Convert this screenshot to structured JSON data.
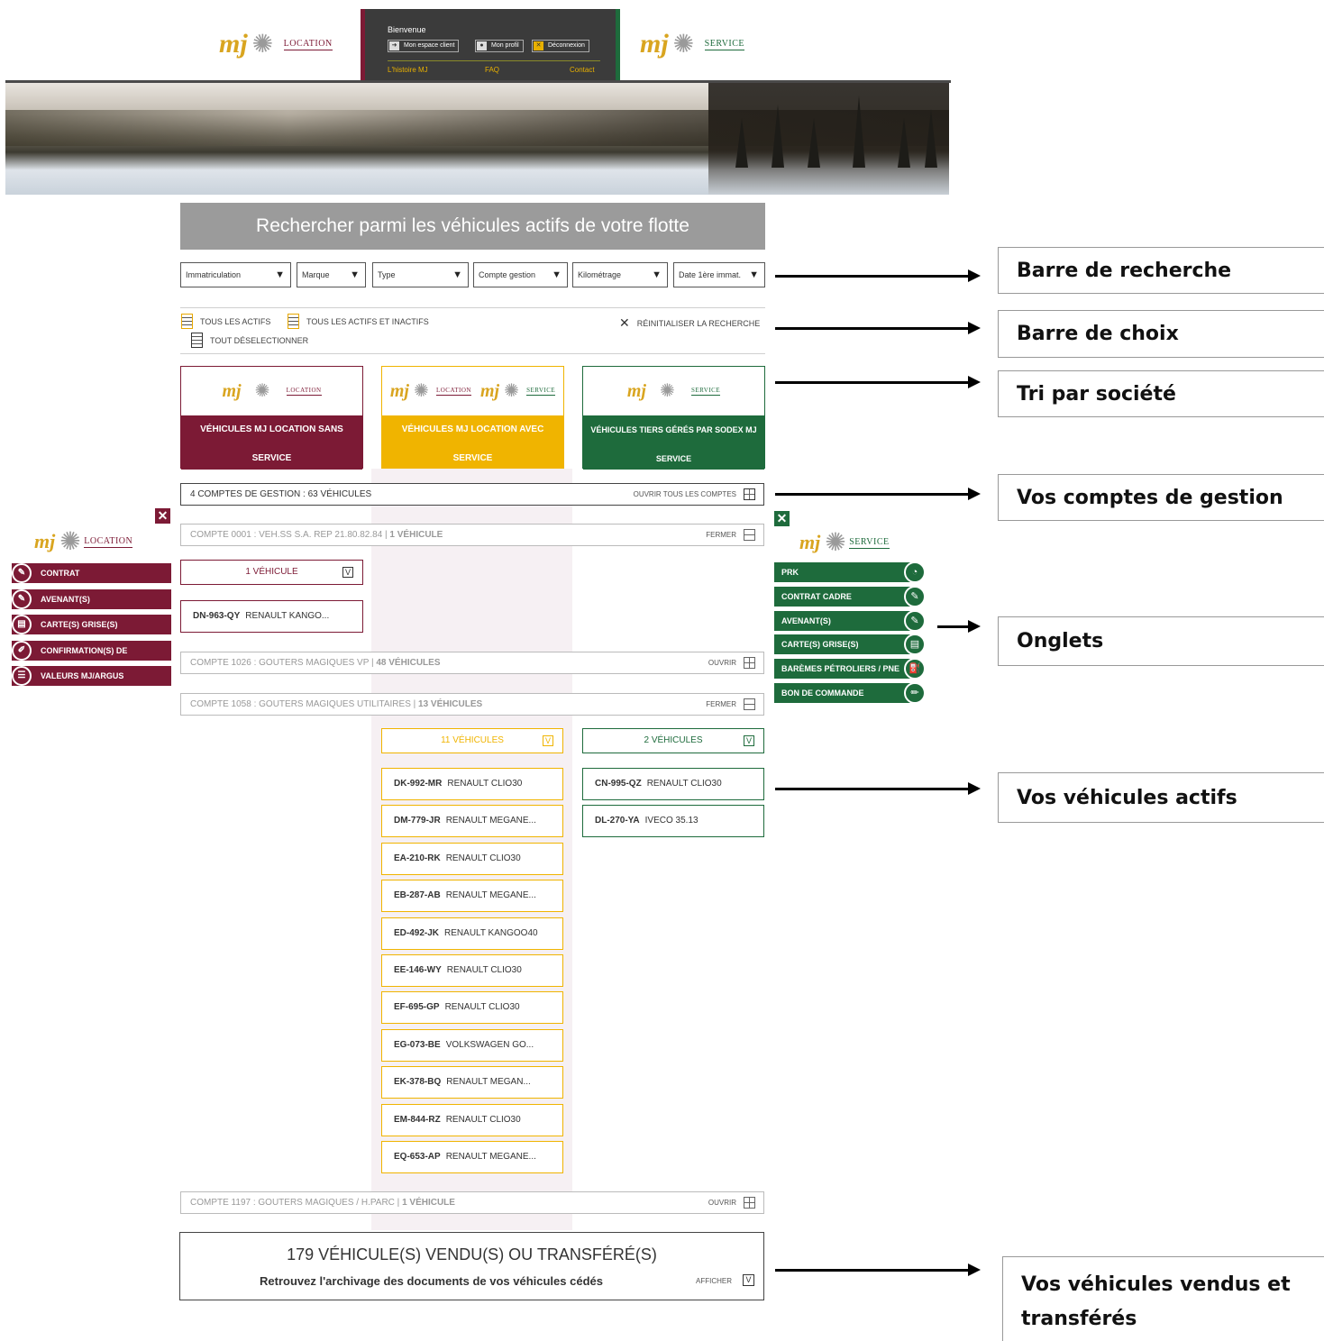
{
  "header": {
    "left_logo": {
      "mark": "mj",
      "label": "LOCATION"
    },
    "right_logo": {
      "mark": "mj",
      "label": "SERVICE"
    },
    "welcome": "Bienvenue",
    "buttons": [
      {
        "label": "Mon espace client",
        "icon": "arrow-icon"
      },
      {
        "label": "Mon profil",
        "icon": "user-icon"
      },
      {
        "label": "Déconnexion",
        "icon": "close-icon"
      }
    ],
    "links": [
      "L'histoire MJ",
      "FAQ",
      "Contact"
    ]
  },
  "search": {
    "title": "Rechercher parmi les véhicules actifs de votre flotte",
    "filters": [
      "Immatriculation",
      "Marque",
      "Type",
      "Compte gestion",
      "Kilométrage",
      "Date 1ère immat."
    ]
  },
  "choices": {
    "all_active": "TOUS LES ACTIFS",
    "all_active_inactive": "TOUS LES ACTIFS ET INACTIFS",
    "deselect_all": "TOUT DÉSELECTIONNER",
    "reset": "RÉINITIALISER LA RECHERCHE"
  },
  "companies": [
    {
      "title": "VÉHICULES MJ LOCATION SANS SERVICE",
      "line1": "VÉHICULES MJ LOCATION SANS",
      "line2": "SERVICE",
      "color": "#7c1a35"
    },
    {
      "title": "VÉHICULES MJ LOCATION AVEC SERVICE",
      "line1": "VÉHICULES MJ LOCATION AVEC",
      "line2": "SERVICE",
      "color": "#f0b400"
    },
    {
      "title": "VÉHICULES TIERS GÉRÉS PAR SODEX MJ SERVICE",
      "line1": "VÉHICULES TIERS GÉRÉS PAR SODEX MJ",
      "line2": "SERVICE",
      "color": "#1e6b3c"
    }
  ],
  "accounts_summary": {
    "label": "4 COMPTES DE GESTION : 63 VÉHICULES",
    "action": "OUVRIR TOUS LES COMPTES"
  },
  "accounts": [
    {
      "prefix": "COMPTE 0001 : VEH.SS S.A. REP 21.80.82.84 | ",
      "count": "1 VÉHICULE",
      "action": "FERMER"
    },
    {
      "prefix": "COMPTE 1026 : GOUTERS MAGIQUES VP | ",
      "count": "48 VÉHICULES",
      "action": "OUVRIR"
    },
    {
      "prefix": "COMPTE 1058 : GOUTERS MAGIQUES UTILITAIRES | ",
      "count": "13 VÉHICULES",
      "action": "FERMER"
    },
    {
      "prefix": "COMPTE 1197 : GOUTERS MAGIQUES / H.PARC | ",
      "count": "1 VÉHICULE",
      "action": "OUVRIR"
    }
  ],
  "groups": {
    "acc1_loc": "1 VÉHICULE",
    "acc3_yellow": "11 VÉHICULES",
    "acc3_green": "2 VÉHICULES",
    "check": "V"
  },
  "vehicles": {
    "acc1_loc": [
      {
        "plate": "DN-963-QY",
        "model": "RENAULT KANGO..."
      }
    ],
    "acc3_yellow": [
      {
        "plate": "DK-992-MR",
        "model": "RENAULT CLIO30"
      },
      {
        "plate": "DM-779-JR",
        "model": "RENAULT MEGANE..."
      },
      {
        "plate": "EA-210-RK",
        "model": "RENAULT CLIO30"
      },
      {
        "plate": "EB-287-AB",
        "model": "RENAULT MEGANE..."
      },
      {
        "plate": "ED-492-JK",
        "model": "RENAULT KANGOO40"
      },
      {
        "plate": "EE-146-WY",
        "model": "RENAULT CLIO30"
      },
      {
        "plate": "EF-695-GP",
        "model": "RENAULT CLIO30"
      },
      {
        "plate": "EG-073-BE",
        "model": "VOLKSWAGEN GO..."
      },
      {
        "plate": "EK-378-BQ",
        "model": "RENAULT MEGAN..."
      },
      {
        "plate": "EM-844-RZ",
        "model": "RENAULT CLIO30"
      },
      {
        "plate": "EQ-653-AP",
        "model": "RENAULT MEGANE..."
      }
    ],
    "acc3_green": [
      {
        "plate": "CN-995-QZ",
        "model": "RENAULT CLIO30"
      },
      {
        "plate": "DL-270-YA",
        "model": "IVECO 35.13"
      }
    ]
  },
  "sold": {
    "title": "179 VÉHICULE(S) VENDU(S) OU TRANSFÉRÉ(S)",
    "subtitle": "Retrouvez l'archivage des documents de vos véhicules cédés",
    "action": "AFFICHER",
    "check": "V"
  },
  "left_menu": {
    "close": "✕",
    "logo_label": "LOCATION",
    "items": [
      {
        "label": "CONTRAT",
        "icon": "document-icon"
      },
      {
        "label": "AVENANT(S)",
        "icon": "document-edit-icon"
      },
      {
        "label": "CARTE(S) GRISE(S)",
        "icon": "card-icon"
      },
      {
        "label": "CONFIRMATION(S) DE",
        "icon": "brush-icon"
      },
      {
        "label": "VALEURS MJ/ARGUS",
        "icon": "list-icon"
      }
    ]
  },
  "right_menu": {
    "close": "✕",
    "logo_label": "SERVICE",
    "items": [
      {
        "label": "PRK",
        "icon": "pie-chart-icon"
      },
      {
        "label": "CONTRAT CADRE",
        "icon": "document-icon"
      },
      {
        "label": "AVENANT(S)",
        "icon": "document-edit-icon"
      },
      {
        "label": "CARTE(S) GRISE(S)",
        "icon": "card-icon"
      },
      {
        "label": "BARÈMES PÉTROLIERS / PNE",
        "icon": "fuel-icon"
      },
      {
        "label": "BON DE COMMANDE",
        "icon": "pencil-icon"
      }
    ]
  },
  "annotations": {
    "search_bar": "Barre de recherche",
    "choice_bar": "Barre de choix",
    "company_sort": "Tri par société",
    "accounts": "Vos comptes de gestion",
    "tabs": "Onglets",
    "active_vehicles": "Vos véhicules actifs",
    "sold_line1": "Vos véhicules vendus et",
    "sold_line2": "transférés"
  },
  "colors": {
    "location": "#7c1a35",
    "location_service": "#f0b400",
    "service": "#1e6b3c"
  }
}
